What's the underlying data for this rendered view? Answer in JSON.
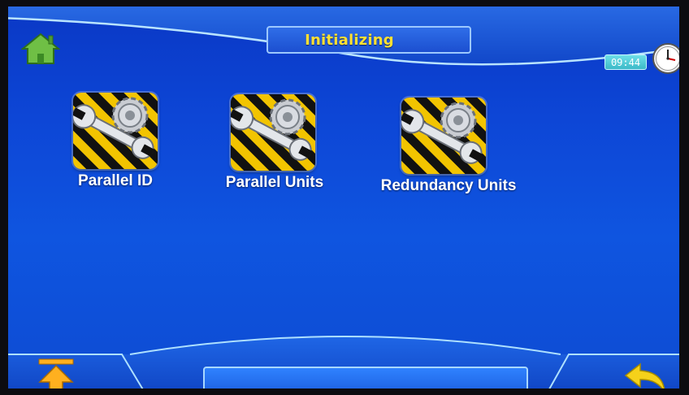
{
  "header": {
    "title": "Initializing",
    "time": "09:44",
    "home_icon": "home-icon",
    "clock_icon": "clock-icon"
  },
  "apps": [
    {
      "label": "Parallel ID",
      "icon": "wrench-gear-icon"
    },
    {
      "label": "Parallel Units",
      "icon": "wrench-gear-icon"
    },
    {
      "label": "Redundancy Units",
      "icon": "wrench-gear-icon"
    }
  ],
  "footer": {
    "left_icon": "upload-arrow-icon",
    "right_icon": "back-arrow-icon",
    "status_text": ""
  },
  "colors": {
    "background": "#0d46d6",
    "title_text": "#ffe033",
    "label_text": "#ffffff",
    "hazard_yellow": "#f2c400",
    "home_green": "#6fbf45",
    "back_arrow": "#f5d11a"
  }
}
